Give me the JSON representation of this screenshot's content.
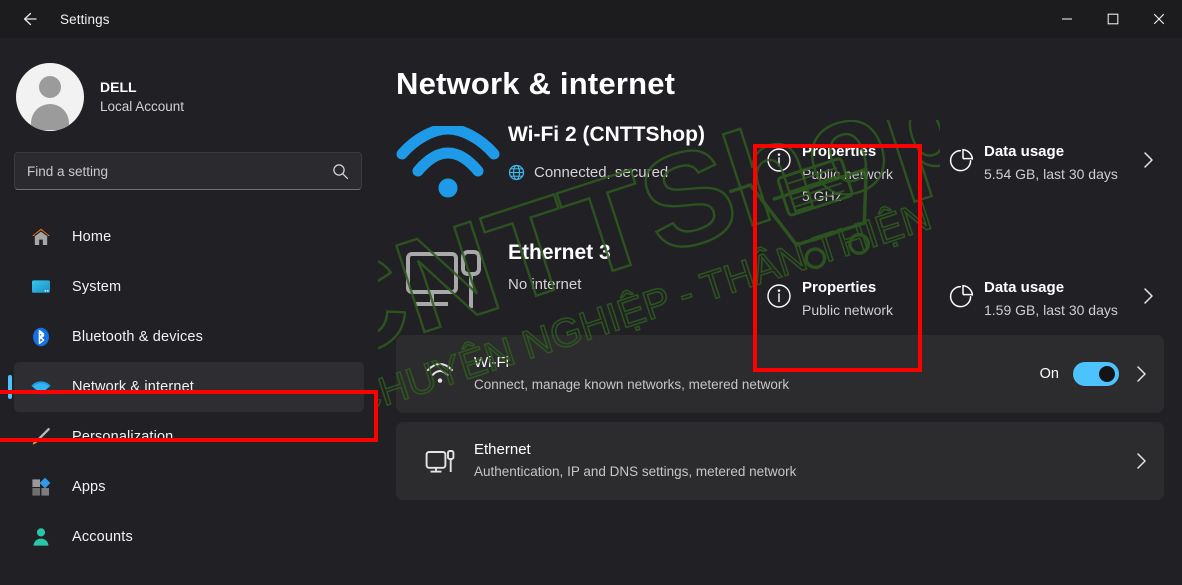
{
  "window": {
    "title": "Settings",
    "back_icon": "back-arrow-icon",
    "minimize_label": "Minimize",
    "maximize_label": "Maximize",
    "close_label": "Close"
  },
  "sidebar": {
    "account": {
      "name": "DELL",
      "type": "Local Account",
      "avatar_icon": "user-avatar-icon"
    },
    "search": {
      "placeholder": "Find a setting",
      "icon": "search-icon"
    },
    "items": [
      {
        "label": "Home",
        "icon": "home-icon",
        "selected": false
      },
      {
        "label": "System",
        "icon": "system-icon",
        "selected": false
      },
      {
        "label": "Bluetooth & devices",
        "icon": "bluetooth-icon",
        "selected": false
      },
      {
        "label": "Network & internet",
        "icon": "wifi-icon",
        "selected": true
      },
      {
        "label": "Personalization",
        "icon": "paintbrush-icon",
        "selected": false
      },
      {
        "label": "Apps",
        "icon": "apps-icon",
        "selected": false
      },
      {
        "label": "Accounts",
        "icon": "accounts-icon",
        "selected": false
      }
    ]
  },
  "main": {
    "page_title": "Network & internet",
    "networks": [
      {
        "name": "Wi-Fi 2 (CNTTShop)",
        "status": "Connected, secured",
        "status_icon": "globe-icon",
        "glyph": "wifi-signal-icon"
      },
      {
        "name": "Ethernet 3",
        "status": "No internet",
        "status_icon": "none",
        "glyph": "ethernet-monitor-icon"
      }
    ],
    "actions": [
      {
        "title": "Properties",
        "lines": [
          "Public network",
          "5 GHz"
        ],
        "icon": "info-icon",
        "chevron": false
      },
      {
        "title": "Data usage",
        "lines": [
          "5.54 GB, last 30 days"
        ],
        "icon": "pie-chart-icon",
        "chevron": true
      },
      {
        "title": "Properties",
        "lines": [
          "Public network"
        ],
        "icon": "info-icon",
        "chevron": false
      },
      {
        "title": "Data usage",
        "lines": [
          "1.59 GB, last 30 days"
        ],
        "icon": "pie-chart-icon",
        "chevron": true
      }
    ],
    "rows": [
      {
        "title": "Wi-Fi",
        "subtitle": "Connect, manage known networks, metered network",
        "icon": "wifi-row-icon",
        "state_label": "On",
        "toggle": true,
        "toggle_on": true
      },
      {
        "title": "Ethernet",
        "subtitle": "Authentication, IP and DNS settings, metered network",
        "icon": "ethernet-row-icon",
        "state_label": "",
        "toggle": false,
        "toggle_on": false
      }
    ]
  },
  "watermark": {
    "brand": "CNTTShop",
    "tagline": "CHUYÊN NGHIỆP - THÂN THIỆN",
    "color": "#2f5c1e"
  },
  "colors": {
    "accent": "#4cc2ff",
    "annotation": "#fe0000",
    "window_bg": "#202025",
    "card_bg": "#2c2c2e",
    "titlebar_bg": "#1c1c1f"
  }
}
